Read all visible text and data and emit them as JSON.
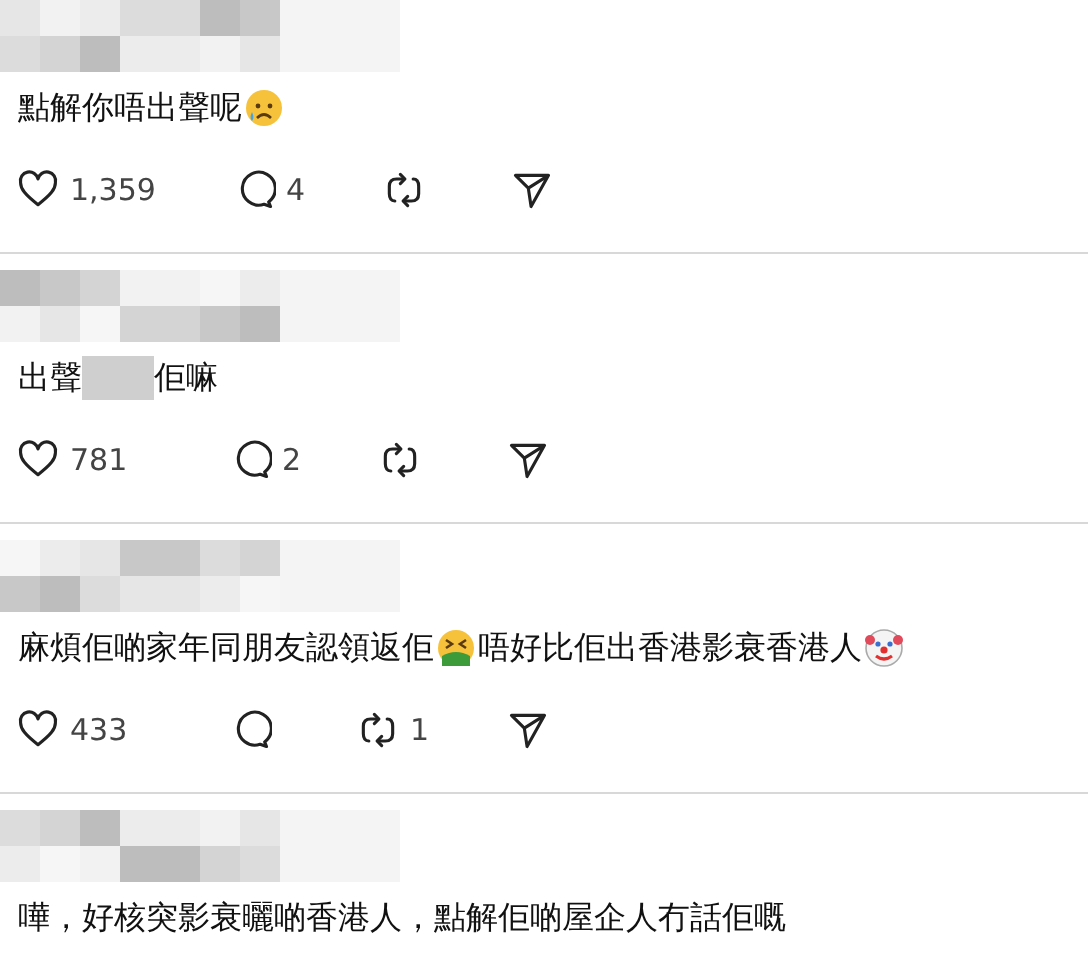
{
  "comments": [
    {
      "segments": [
        {
          "kind": "text",
          "text": "點解你唔出聲呢"
        },
        {
          "kind": "emoji"
        }
      ],
      "likes": "1,359",
      "replies": "4"
    },
    {
      "segments": [
        {
          "kind": "text",
          "text": "出聲"
        },
        {
          "kind": "redacted"
        },
        {
          "kind": "text",
          "text": "佢嘛"
        }
      ],
      "likes": "781",
      "replies": "2"
    },
    {
      "segments": [
        {
          "kind": "text",
          "text": "麻煩佢啲家年同朋友認領返佢"
        },
        {
          "kind": "emoji"
        },
        {
          "kind": "text",
          "text": "唔好比佢出香港影衰香港人"
        },
        {
          "kind": "emoji"
        }
      ],
      "likes": "433",
      "reposts": "1"
    },
    {
      "segments": [
        {
          "kind": "text",
          "text": "嘩，好核突影衰曬啲香港人，點解佢啲屋企人冇話佢嘅"
        }
      ]
    }
  ]
}
